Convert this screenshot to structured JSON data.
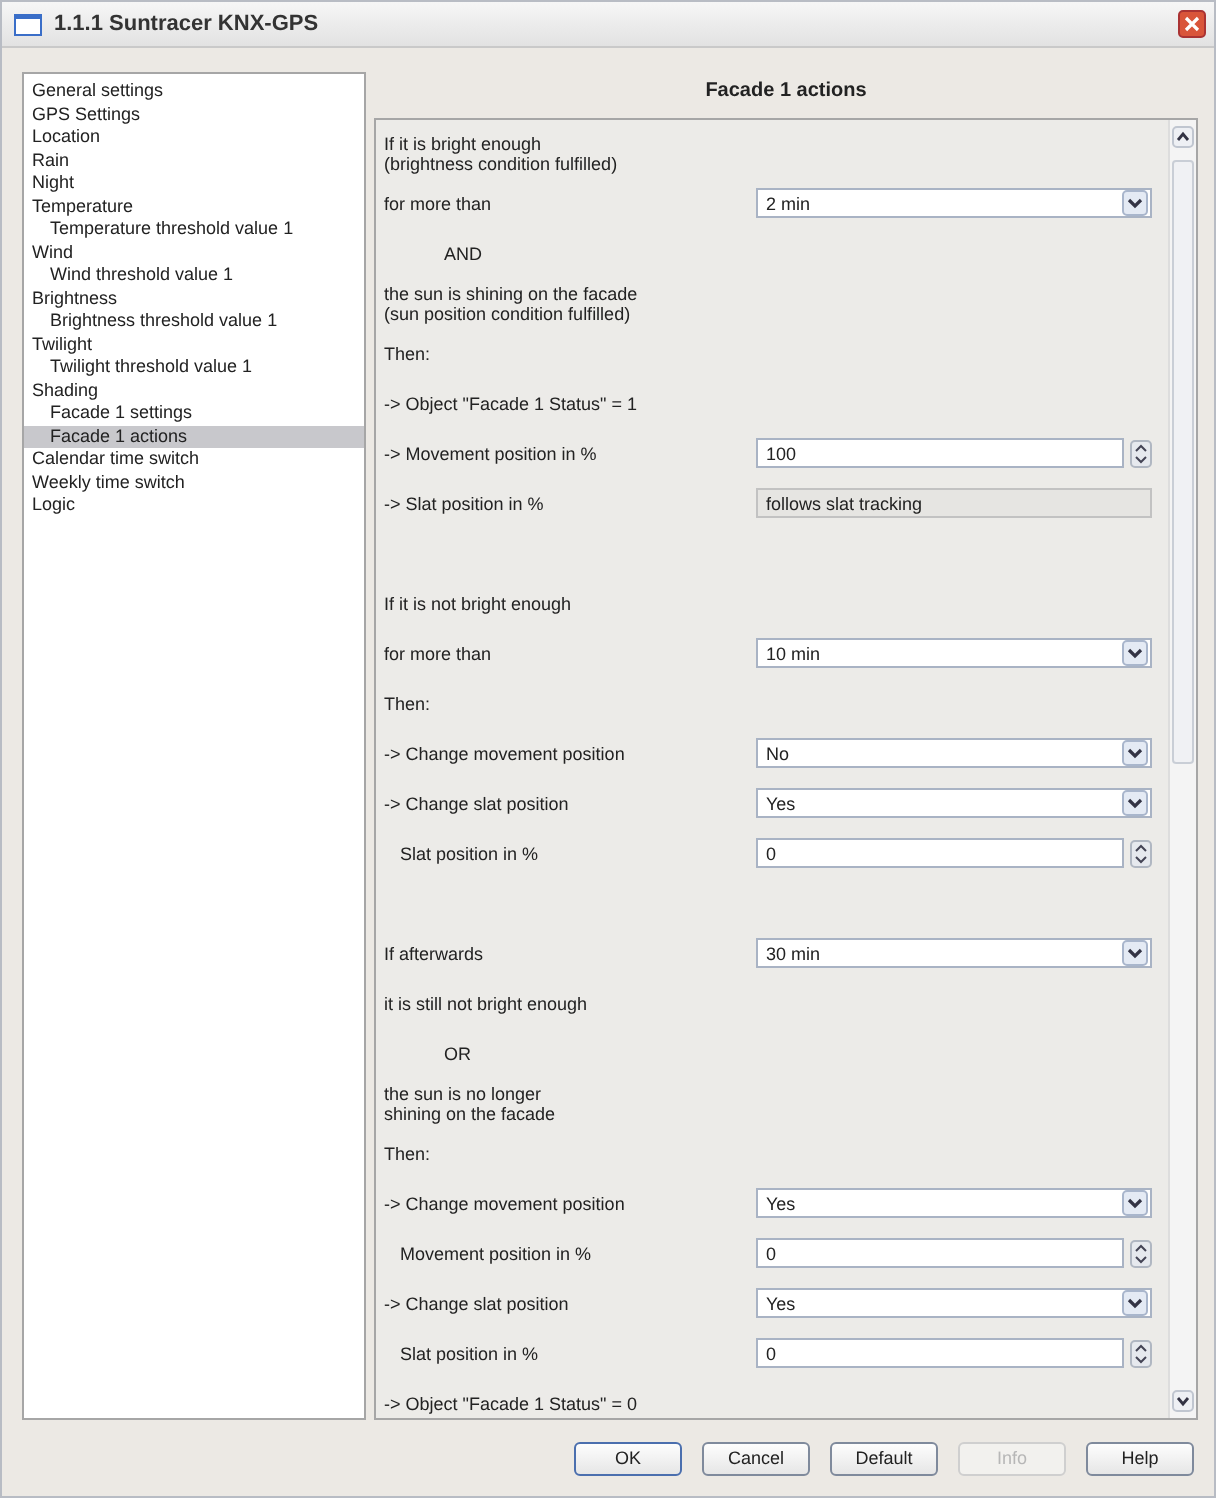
{
  "window": {
    "title": "1.1.1 Suntracer KNX-GPS"
  },
  "sidebar": {
    "items": [
      {
        "label": "General settings",
        "selected": false
      },
      {
        "label": "GPS Settings",
        "selected": false
      },
      {
        "label": "Location",
        "selected": false
      },
      {
        "label": "Rain",
        "selected": false
      },
      {
        "label": "Night",
        "selected": false
      },
      {
        "label": "Temperature",
        "selected": false,
        "children": [
          {
            "label": "Temperature threshold value 1",
            "selected": false
          }
        ]
      },
      {
        "label": "Wind",
        "selected": false,
        "children": [
          {
            "label": "Wind threshold value 1",
            "selected": false
          }
        ]
      },
      {
        "label": "Brightness",
        "selected": false,
        "children": [
          {
            "label": "Brightness threshold value 1",
            "selected": false
          }
        ]
      },
      {
        "label": "Twilight",
        "selected": false,
        "children": [
          {
            "label": "Twilight threshold value 1",
            "selected": false
          }
        ]
      },
      {
        "label": "Shading",
        "selected": false,
        "children": [
          {
            "label": "Facade 1 settings",
            "selected": false
          },
          {
            "label": "Facade 1 actions",
            "selected": true
          }
        ]
      },
      {
        "label": "Calendar time switch",
        "selected": false
      },
      {
        "label": "Weekly time switch",
        "selected": false
      },
      {
        "label": "Logic",
        "selected": false
      }
    ]
  },
  "panel": {
    "title": "Facade 1 actions",
    "rows": [
      {
        "kind": "text",
        "label": "If it is bright enough\n(brightness condition fulfilled)",
        "indented": false
      },
      {
        "kind": "dropdown",
        "label": "for more than",
        "value": "2 min",
        "indented": false
      },
      {
        "kind": "operator",
        "label": "AND"
      },
      {
        "kind": "text",
        "label": "the sun is shining on the facade\n(sun position condition fulfilled)",
        "indented": false
      },
      {
        "kind": "text",
        "label": "Then:",
        "indented": false
      },
      {
        "kind": "text",
        "label": "-> Object \"Facade 1 Status\" = 1",
        "indented": false
      },
      {
        "kind": "spinner",
        "label": "-> Movement position in %",
        "value": "100",
        "indented": false
      },
      {
        "kind": "readonly",
        "label": "-> Slat position in %",
        "value": "follows slat tracking",
        "indented": false
      },
      {
        "kind": "spacer"
      },
      {
        "kind": "text",
        "label": "If it is not bright enough",
        "indented": false
      },
      {
        "kind": "dropdown",
        "label": "for more than",
        "value": "10 min",
        "indented": false
      },
      {
        "kind": "text",
        "label": "Then:",
        "indented": false
      },
      {
        "kind": "dropdown",
        "label": "-> Change movement position",
        "value": "No",
        "indented": false
      },
      {
        "kind": "dropdown",
        "label": "-> Change slat position",
        "value": "Yes",
        "indented": false
      },
      {
        "kind": "spinner",
        "label": "Slat position in %",
        "value": "0",
        "indented": true
      },
      {
        "kind": "spacer"
      },
      {
        "kind": "dropdown",
        "label": "If afterwards",
        "value": "30 min",
        "indented": false
      },
      {
        "kind": "text",
        "label": "it is still not bright enough",
        "indented": false
      },
      {
        "kind": "operator",
        "label": "OR"
      },
      {
        "kind": "text",
        "label": "the sun is no longer\nshining on the facade",
        "indented": false
      },
      {
        "kind": "text",
        "label": "Then:",
        "indented": false
      },
      {
        "kind": "dropdown",
        "label": "-> Change movement position",
        "value": "Yes",
        "indented": false
      },
      {
        "kind": "spinner",
        "label": "Movement position in %",
        "value": "0",
        "indented": true
      },
      {
        "kind": "dropdown",
        "label": "-> Change slat position",
        "value": "Yes",
        "indented": false
      },
      {
        "kind": "spinner",
        "label": "Slat position in %",
        "value": "0",
        "indented": true
      },
      {
        "kind": "text",
        "label": "-> Object \"Facade 1 Status\" = 0",
        "indented": false
      }
    ]
  },
  "buttons": [
    {
      "label": "OK",
      "disabled": false
    },
    {
      "label": "Cancel",
      "disabled": false
    },
    {
      "label": "Default",
      "disabled": false
    },
    {
      "label": "Info",
      "disabled": true
    },
    {
      "label": "Help",
      "disabled": false
    }
  ]
}
